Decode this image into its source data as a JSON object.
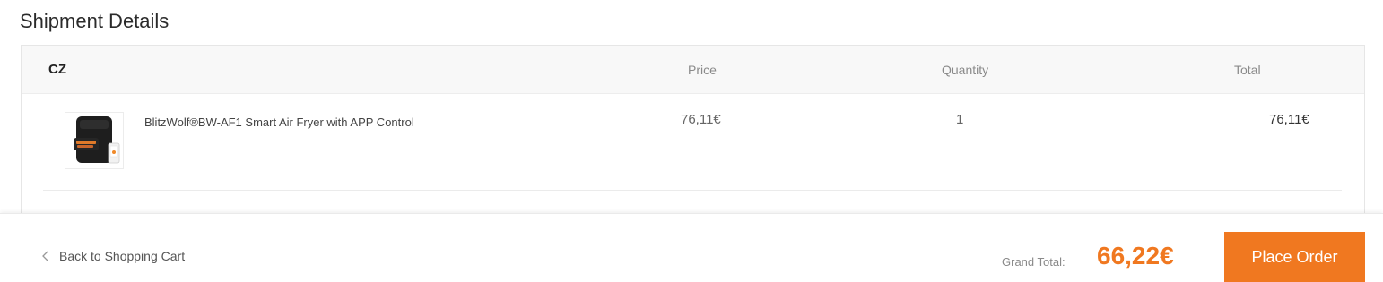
{
  "section": {
    "title": "Shipment Details"
  },
  "table": {
    "country": "CZ",
    "headers": {
      "price": "Price",
      "quantity": "Quantity",
      "total": "Total"
    },
    "items": [
      {
        "name": "BlitzWolf®BW-AF1 Smart Air Fryer with APP Control",
        "price": "76,11€",
        "quantity": "1",
        "total": "76,11€",
        "image_icon": "air-fryer-product-image"
      }
    ]
  },
  "footer": {
    "back_label": "Back to Shopping Cart",
    "grand_total_label": "Grand Total:",
    "grand_total_value": "66,22€",
    "place_order_label": "Place Order"
  },
  "colors": {
    "accent": "#f07820",
    "header_bg": "#f8f8f8"
  }
}
